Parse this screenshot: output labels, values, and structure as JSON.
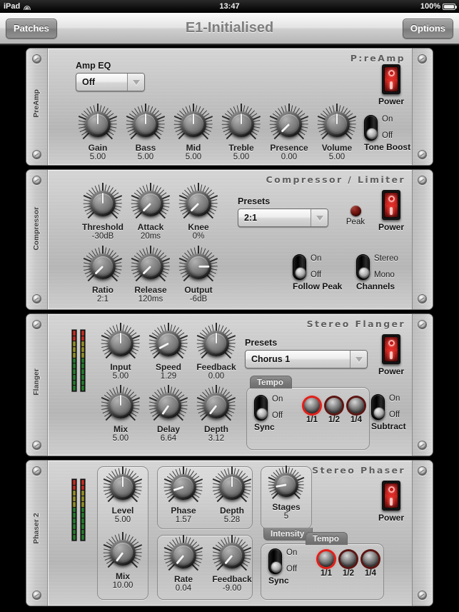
{
  "status_bar": {
    "device": "iPad",
    "wifi_icon": "wifi-icon",
    "time": "13:47",
    "battery_percent": "100%",
    "battery_icon": "battery-icon"
  },
  "nav_bar": {
    "left_button": "Patches",
    "title": "E1-Initialised",
    "right_button": "Options"
  },
  "modules": [
    {
      "rail_label": "PreAmp",
      "title": "P:reAmp",
      "eq_label": "Amp EQ",
      "eq_value": "Off",
      "knobs": [
        {
          "name": "Gain",
          "value": "5.00",
          "angle": 0
        },
        {
          "name": "Bass",
          "value": "5.00",
          "angle": 0
        },
        {
          "name": "Mid",
          "value": "5.00",
          "angle": 0
        },
        {
          "name": "Treble",
          "value": "5.00",
          "angle": 0
        },
        {
          "name": "Presence",
          "value": "0.00",
          "angle": -135
        },
        {
          "name": "Volume",
          "value": "5.00",
          "angle": 0
        }
      ],
      "power": {
        "label": "Power",
        "state": "on"
      },
      "toggle": {
        "name": "Tone Boost",
        "on_label": "On",
        "off_label": "Off",
        "state": "off"
      }
    },
    {
      "rail_label": "Compressor",
      "title": "Compressor / Limiter",
      "presets_label": "Presets",
      "presets_value": "2:1",
      "knobs": [
        {
          "name": "Threshold",
          "value": "-30dB",
          "angle": 0
        },
        {
          "name": "Attack",
          "value": "20ms",
          "angle": -135
        },
        {
          "name": "Knee",
          "value": "0%",
          "angle": -135
        },
        {
          "name": "Ratio",
          "value": "2:1",
          "angle": -135
        },
        {
          "name": "Release",
          "value": "120ms",
          "angle": -135
        },
        {
          "name": "Output",
          "value": "-6dB",
          "angle": 90
        }
      ],
      "peak": {
        "label": "Peak",
        "state": "off"
      },
      "power": {
        "label": "Power",
        "state": "on"
      },
      "toggles": [
        {
          "name": "Follow Peak",
          "on_label": "On",
          "off_label": "Off",
          "state": "off"
        },
        {
          "name": "Channels",
          "on_label": "Stereo",
          "off_label": "Mono",
          "state": "off"
        }
      ]
    },
    {
      "rail_label": "Flanger",
      "title": "Stereo Flanger",
      "presets_label": "Presets",
      "presets_value": "Chorus 1",
      "knobs": [
        {
          "name": "Input",
          "value": "5.00",
          "angle": 0
        },
        {
          "name": "Speed",
          "value": "1.29",
          "angle": -118
        },
        {
          "name": "Feedback",
          "value": "0.00",
          "angle": 0
        },
        {
          "name": "Mix",
          "value": "5.00",
          "angle": 0
        },
        {
          "name": "Delay",
          "value": "6.64",
          "angle": -145
        },
        {
          "name": "Depth",
          "value": "3.12",
          "angle": -142
        }
      ],
      "tempo": {
        "group_label": "Tempo",
        "sync": {
          "name": "Sync",
          "on_label": "On",
          "off_label": "Off",
          "state": "off"
        },
        "buttons": [
          {
            "label": "1/1",
            "active": true
          },
          {
            "label": "1/2",
            "active": false
          },
          {
            "label": "1/4",
            "active": false
          }
        ]
      },
      "power": {
        "label": "Power",
        "state": "on"
      },
      "toggle": {
        "name": "Subtract",
        "on_label": "On",
        "off_label": "Off",
        "state": "off"
      },
      "meter": {
        "name": "level-meter",
        "channels": 2
      }
    },
    {
      "rail_label": "Phaser 2",
      "title": "Stereo Phaser",
      "knobs": [
        {
          "name": "Level",
          "value": "5.00",
          "angle": 0
        },
        {
          "name": "Mix",
          "value": "10.00",
          "angle": -143
        },
        {
          "name": "Phase",
          "value": "1.57",
          "angle": -108
        },
        {
          "name": "Depth",
          "value": "5.28",
          "angle": 0
        },
        {
          "name": "Rate",
          "value": "0.04",
          "angle": -140
        },
        {
          "name": "Feedback",
          "value": "-9.00",
          "angle": -140
        },
        {
          "name": "Stages",
          "value": "5",
          "angle": -100
        }
      ],
      "intensity_label": "Intensity",
      "tempo": {
        "group_label": "Tempo",
        "sync": {
          "name": "Sync",
          "on_label": "On",
          "off_label": "Off",
          "state": "off"
        },
        "buttons": [
          {
            "label": "1/1",
            "active": true
          },
          {
            "label": "1/2",
            "active": false
          },
          {
            "label": "1/4",
            "active": false
          }
        ]
      },
      "power": {
        "label": "Power",
        "state": "on"
      },
      "meter": {
        "name": "level-meter",
        "channels": 2
      }
    }
  ],
  "colors": {
    "panel": "#c4c4c4",
    "led_active": "#e11f19",
    "power_red": "#e02b24",
    "text": "#1c1c1c"
  }
}
